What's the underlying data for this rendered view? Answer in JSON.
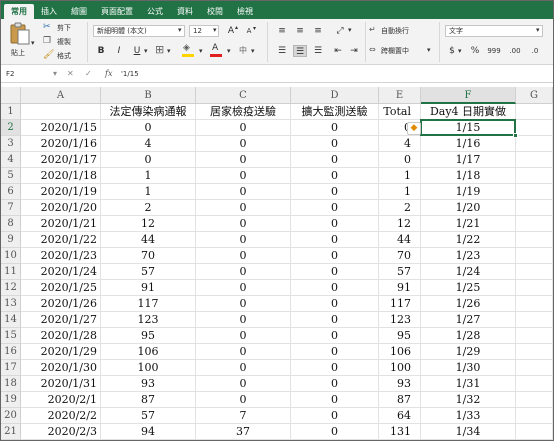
{
  "tabs": [
    "常用",
    "插入",
    "繪圖",
    "頁面配置",
    "公式",
    "資料",
    "校閱",
    "檢視"
  ],
  "ribbon": {
    "paste_label": "貼上",
    "cut_label": "剪下",
    "copy_label": "複製",
    "format_painter_label": "格式",
    "font_name": "新細明體 (本文)",
    "font_size": "12",
    "grow_font": "A",
    "shrink_font": "A",
    "bold": "B",
    "italic": "I",
    "underline": "U",
    "wrap_text_label": "自動換行",
    "merge_center_label": "跨欄置中",
    "number_format": "文字",
    "currency": "$",
    "percent": "%",
    "comma": "999",
    "increase_decimal": ".00",
    "decrease_decimal": ".0"
  },
  "formula_bar": {
    "name_box": "F2",
    "fx": "fx",
    "value": "'1/15"
  },
  "columns": [
    "A",
    "B",
    "C",
    "D",
    "E",
    "F",
    "G"
  ],
  "active_column": "F",
  "header_row": {
    "row": "1",
    "a": "",
    "b": "法定傳染病通報",
    "c": "居家檢疫送驗",
    "d": "擴大監測送驗",
    "e": "Total",
    "f": "Day4 日期實做"
  },
  "rows": [
    {
      "row": "2",
      "a": "2020/1/15",
      "b": "0",
      "c": "0",
      "d": "0",
      "e": "0",
      "f": "1/15"
    },
    {
      "row": "3",
      "a": "2020/1/16",
      "b": "4",
      "c": "0",
      "d": "0",
      "e": "4",
      "f": "1/16"
    },
    {
      "row": "4",
      "a": "2020/1/17",
      "b": "0",
      "c": "0",
      "d": "0",
      "e": "0",
      "f": "1/17"
    },
    {
      "row": "5",
      "a": "2020/1/18",
      "b": "1",
      "c": "0",
      "d": "0",
      "e": "1",
      "f": "1/18"
    },
    {
      "row": "6",
      "a": "2020/1/19",
      "b": "1",
      "c": "0",
      "d": "0",
      "e": "1",
      "f": "1/19"
    },
    {
      "row": "7",
      "a": "2020/1/20",
      "b": "2",
      "c": "0",
      "d": "0",
      "e": "2",
      "f": "1/20"
    },
    {
      "row": "8",
      "a": "2020/1/21",
      "b": "12",
      "c": "0",
      "d": "0",
      "e": "12",
      "f": "1/21"
    },
    {
      "row": "9",
      "a": "2020/1/22",
      "b": "44",
      "c": "0",
      "d": "0",
      "e": "44",
      "f": "1/22"
    },
    {
      "row": "10",
      "a": "2020/1/23",
      "b": "70",
      "c": "0",
      "d": "0",
      "e": "70",
      "f": "1/23"
    },
    {
      "row": "11",
      "a": "2020/1/24",
      "b": "57",
      "c": "0",
      "d": "0",
      "e": "57",
      "f": "1/24"
    },
    {
      "row": "12",
      "a": "2020/1/25",
      "b": "91",
      "c": "0",
      "d": "0",
      "e": "91",
      "f": "1/25"
    },
    {
      "row": "13",
      "a": "2020/1/26",
      "b": "117",
      "c": "0",
      "d": "0",
      "e": "117",
      "f": "1/26"
    },
    {
      "row": "14",
      "a": "2020/1/27",
      "b": "123",
      "c": "0",
      "d": "0",
      "e": "123",
      "f": "1/27"
    },
    {
      "row": "15",
      "a": "2020/1/28",
      "b": "95",
      "c": "0",
      "d": "0",
      "e": "95",
      "f": "1/28"
    },
    {
      "row": "16",
      "a": "2020/1/29",
      "b": "106",
      "c": "0",
      "d": "0",
      "e": "106",
      "f": "1/29"
    },
    {
      "row": "17",
      "a": "2020/1/30",
      "b": "100",
      "c": "0",
      "d": "0",
      "e": "100",
      "f": "1/30"
    },
    {
      "row": "18",
      "a": "2020/1/31",
      "b": "93",
      "c": "0",
      "d": "0",
      "e": "93",
      "f": "1/31"
    },
    {
      "row": "19",
      "a": "2020/2/1",
      "b": "87",
      "c": "0",
      "d": "0",
      "e": "87",
      "f": "1/32"
    },
    {
      "row": "20",
      "a": "2020/2/2",
      "b": "57",
      "c": "7",
      "d": "0",
      "e": "64",
      "f": "1/33"
    },
    {
      "row": "21",
      "a": "2020/2/3",
      "b": "94",
      "c": "37",
      "d": "0",
      "e": "131",
      "f": "1/34"
    }
  ],
  "colors": {
    "accent": "#217346",
    "font_color_swatch": "#e02020",
    "fill_color_swatch": "#ffd400"
  },
  "icons": {
    "paste": "paste-clipboard-icon",
    "cut": "scissors-icon",
    "copy": "copy-icon",
    "format_painter": "paintbrush-icon",
    "smart_tag": "error-warning-icon"
  }
}
